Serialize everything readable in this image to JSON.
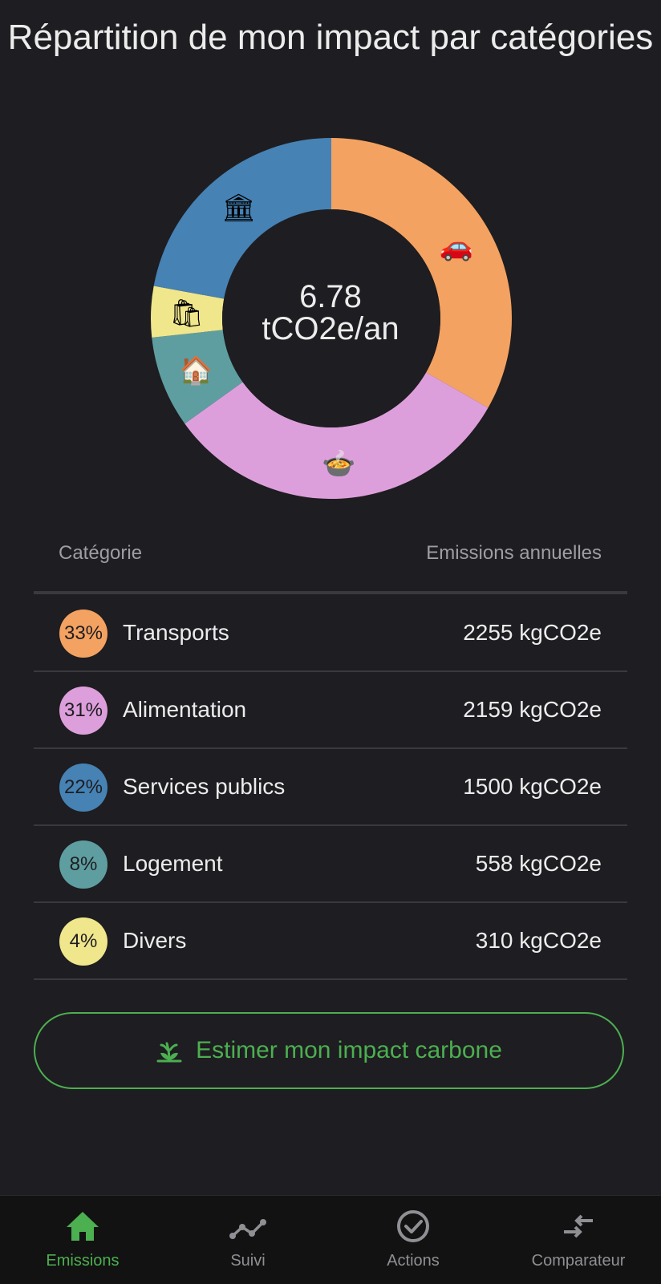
{
  "page_title": "Répartition de mon impact par catégories",
  "total": {
    "value": "6.78",
    "unit": "tCO2e/an"
  },
  "table": {
    "col_category": "Catégorie",
    "col_emissions": "Emissions annuelles",
    "rows": [
      {
        "percent": "33%",
        "name": "Transports",
        "value": "2255 kgCO2e",
        "color": "#f4a261",
        "icon": "car-icon",
        "glyph": "🚗"
      },
      {
        "percent": "31%",
        "name": "Alimentation",
        "value": "2159 kgCO2e",
        "color": "#dd9fdb",
        "icon": "food-pot-icon",
        "glyph": "🍲"
      },
      {
        "percent": "22%",
        "name": "Services publics",
        "value": "1500 kgCO2e",
        "color": "#4682b4",
        "icon": "public-building-icon",
        "glyph": "🏛"
      },
      {
        "percent": "8%",
        "name": "Logement",
        "value": "558 kgCO2e",
        "color": "#5f9ea0",
        "icon": "house-icon",
        "glyph": "🏠"
      },
      {
        "percent": "4%",
        "name": "Divers",
        "value": "310 kgCO2e",
        "color": "#f0e68c",
        "icon": "shopping-bags-icon",
        "glyph": "🛍"
      }
    ]
  },
  "chart_data": {
    "type": "pie",
    "variant": "donut",
    "categories": [
      "Transports",
      "Alimentation",
      "Services publics",
      "Logement",
      "Divers"
    ],
    "values": [
      2255,
      2159,
      1500,
      558,
      310
    ],
    "unit": "kgCO2e",
    "colors": [
      "#f4a261",
      "#dd9fdb",
      "#4682b4",
      "#5f9ea0",
      "#f0e68c"
    ],
    "order_clockwise_from_top": [
      "Transports",
      "Alimentation",
      "Logement",
      "Divers",
      "Services publics"
    ]
  },
  "cta": {
    "label": "Estimer mon impact carbone",
    "icon": "sprout-icon",
    "color": "#4caf50"
  },
  "nav": {
    "active_color": "#4caf50",
    "items": [
      {
        "label": "Emissions",
        "icon": "home-icon",
        "active": true
      },
      {
        "label": "Suivi",
        "icon": "trend-line-icon",
        "active": false
      },
      {
        "label": "Actions",
        "icon": "check-circle-icon",
        "active": false
      },
      {
        "label": "Comparateur",
        "icon": "compare-arrows-icon",
        "active": false
      }
    ]
  }
}
